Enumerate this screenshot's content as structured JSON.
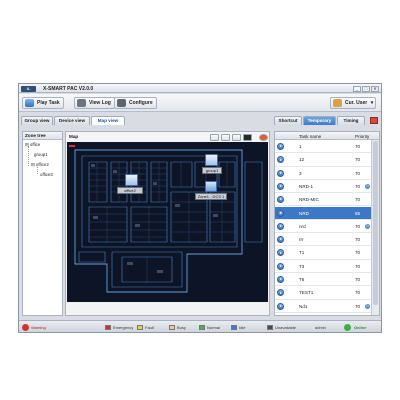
{
  "app": {
    "logo_text": "X-SMART",
    "title": "X-SMART PAC V2.0.0"
  },
  "window_controls": {
    "minimize": "_",
    "maximize": "□",
    "close": "✕"
  },
  "toolbar": {
    "play_task": "Play Task",
    "view_log": "View Log",
    "configure": "Configure",
    "user": "Cur. User",
    "user_dropdown": "▾"
  },
  "view_tabs": [
    "Group view",
    "Device view",
    "Map view"
  ],
  "active_view_tab": "Map view",
  "right_tabs": [
    "Shortcut",
    "Temporary",
    "Timing"
  ],
  "active_right_tab": "Temporary",
  "zone_tree": {
    "title": "Zone tree",
    "items": [
      "office",
      "group1",
      "office2",
      "office3"
    ]
  },
  "map": {
    "title": "Map",
    "labels": [
      "office2",
      "group1",
      "Zone1 - DCS 1"
    ]
  },
  "tasks": {
    "columns": [
      "Task name",
      "Priority"
    ],
    "rows": [
      {
        "name": "1",
        "priority": "70"
      },
      {
        "name": "12",
        "priority": "70"
      },
      {
        "name": "3",
        "priority": "70"
      },
      {
        "name": "NRD-1",
        "priority": "70",
        "icon": true
      },
      {
        "name": "NRD-MIC",
        "priority": "70"
      },
      {
        "name": "NRD",
        "priority": "65",
        "selected": true
      },
      {
        "name": "nrd",
        "priority": "70",
        "icon": true
      },
      {
        "name": "rrr",
        "priority": "70"
      },
      {
        "name": "T1",
        "priority": "70"
      },
      {
        "name": "T3",
        "priority": "70"
      },
      {
        "name": "T6",
        "priority": "70"
      },
      {
        "name": "TEST1",
        "priority": "70"
      },
      {
        "name": "Nd1",
        "priority": "70",
        "icon": true
      }
    ]
  },
  "status": {
    "warning": "Warning",
    "legend": [
      {
        "label": "Emergency",
        "color": "#d62d2d"
      },
      {
        "label": "Fault",
        "color": "#f2d22e"
      },
      {
        "label": "Busy",
        "color": "#f4c59a"
      },
      {
        "label": "Normal",
        "color": "#45b04a"
      },
      {
        "label": "Idle",
        "color": "#3a7bd5"
      },
      {
        "label": "Unavailable",
        "color": "#4a4a4a"
      }
    ],
    "user": "admin",
    "connection": "Online"
  },
  "colors": {
    "accent": "#3d78c7",
    "map_bg": "#0d1426"
  }
}
